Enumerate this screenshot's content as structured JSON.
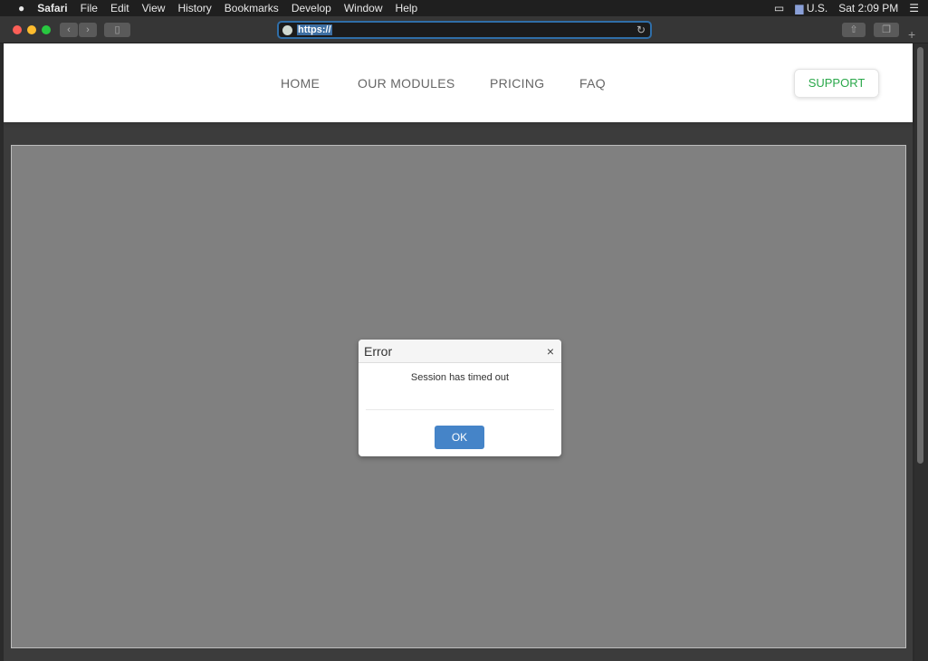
{
  "menubar": {
    "apple": "",
    "app": "Safari",
    "items": [
      "File",
      "Edit",
      "View",
      "History",
      "Bookmarks",
      "Develop",
      "Window",
      "Help"
    ],
    "input_source": "U.S.",
    "clock": "Sat 2:09 PM"
  },
  "toolbar": {
    "url": "https://",
    "back": "‹",
    "forward": "›"
  },
  "nav": {
    "links": [
      "HOME",
      "OUR MODULES",
      "PRICING",
      "FAQ"
    ],
    "support": "SUPPORT"
  },
  "modal": {
    "title": "Error",
    "close": "×",
    "message": "Session has timed out",
    "ok": "OK"
  },
  "colors": {
    "accent": "#4584c8",
    "support": "#2aa84a",
    "overlay": "#808080"
  }
}
